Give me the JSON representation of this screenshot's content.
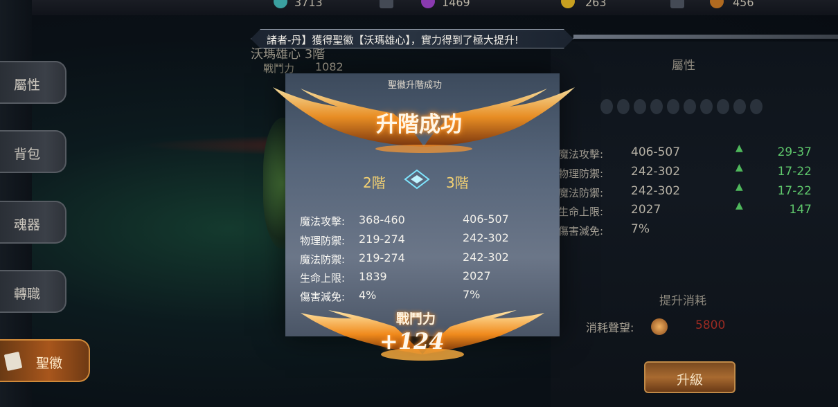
{
  "top_resources": [
    "3713",
    "1469",
    "263",
    "456"
  ],
  "sidebar": {
    "items": [
      {
        "label": "屬性"
      },
      {
        "label": "背包"
      },
      {
        "label": "魂器"
      },
      {
        "label": "轉職"
      },
      {
        "label": "聖徽"
      }
    ]
  },
  "announcement": "諸者-丹】獲得聖徽【沃瑪雄心】，實力得到了極大提升!",
  "hero": {
    "name": "沃瑪雄心 3階",
    "power_label": "戰鬥力",
    "power_value": "1082"
  },
  "dialog": {
    "header": "聖徽升階成功",
    "title": "升階成功",
    "from_tier": "2階",
    "to_tier": "3階",
    "stats": [
      {
        "name": "魔法攻擊:",
        "before": "368-460",
        "after": "406-507"
      },
      {
        "name": "物理防禦:",
        "before": "219-274",
        "after": "242-302"
      },
      {
        "name": "魔法防禦:",
        "before": "219-274",
        "after": "242-302"
      },
      {
        "name": "生命上限:",
        "before": "1839",
        "after": "2027"
      },
      {
        "name": "傷害減免:",
        "before": "4%",
        "after": "7%"
      }
    ],
    "combat_label": "戰鬥力",
    "combat_gain": "+124"
  },
  "right_panel": {
    "title": "屬性",
    "rows": [
      {
        "name": "魔法攻擊:",
        "value": "406-507",
        "increase": "29-37"
      },
      {
        "name": "物理防禦:",
        "value": "242-302",
        "increase": "17-22"
      },
      {
        "name": "魔法防禦:",
        "value": "242-302",
        "increase": "17-22"
      },
      {
        "name": "生命上限:",
        "value": "2027",
        "increase": "147"
      },
      {
        "name": "傷害減免:",
        "value": "7%",
        "increase": ""
      }
    ],
    "cost_title": "提升消耗",
    "cost_label": "消耗聲望:",
    "cost_value": "5800",
    "upgrade_button": "升級"
  },
  "colors": {
    "accent_orange": "#ff8a1e",
    "increase_green": "#5fc86c",
    "cost_red": "#9a2a22",
    "tier_gold": "#f5d272"
  },
  "icons": [
    "sword-icon",
    "gem-icon",
    "gold-coin-icon",
    "medal-icon",
    "book-icon",
    "diamond-arrow-icon",
    "up-arrow-icon"
  ]
}
